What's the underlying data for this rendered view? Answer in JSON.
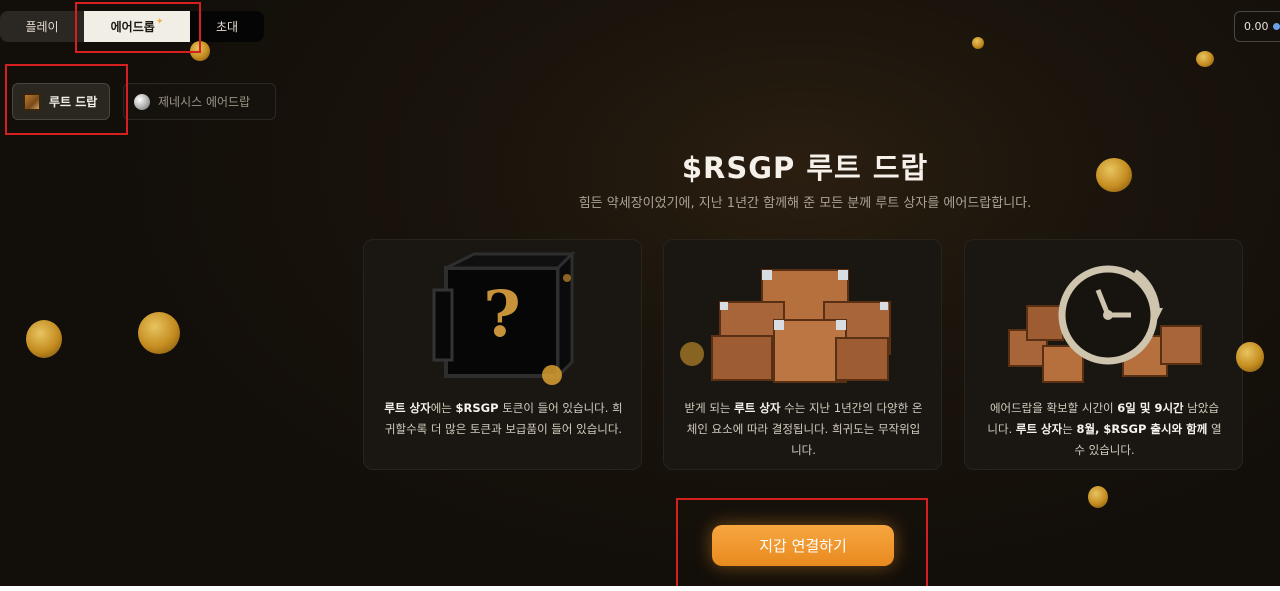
{
  "top_tabs": [
    {
      "label": "플레이"
    },
    {
      "label": "에어드롭"
    },
    {
      "label": "초대"
    }
  ],
  "balance": "0.00",
  "sub_tabs": [
    {
      "label": "루트 드랍"
    },
    {
      "label": "제네시스 에어드랍"
    }
  ],
  "hero": {
    "title": "$RSGP 루트 드랍",
    "subtitle": "힘든 약세장이었기에, 지난 1년간 함께해 준 모든 분께 루트 상자를 에어드랍합니다."
  },
  "cards": [
    {
      "parts": [
        {
          "t": "루트 상자",
          "b": true
        },
        {
          "t": "에는 ",
          "b": false
        },
        {
          "t": "$RSGP",
          "b": true
        },
        {
          "t": " 토큰이 들어 있습니다. 희귀할수록 더 많은 토큰과 보급품이 들어 있습니다.",
          "b": false
        }
      ]
    },
    {
      "parts": [
        {
          "t": "받게 되는 ",
          "b": false
        },
        {
          "t": "루트 상자",
          "b": true
        },
        {
          "t": " 수는 지난 1년간의 다양한 온체인 요소에 따라 결정됩니다. 희귀도는 무작위입니다.",
          "b": false
        }
      ]
    },
    {
      "parts": [
        {
          "t": "에어드랍을 확보할 시간이 ",
          "b": false
        },
        {
          "t": "6일 및 9시간",
          "b": true
        },
        {
          "t": " 남았습니다. ",
          "b": false
        },
        {
          "t": "루트 상자",
          "b": true
        },
        {
          "t": "는 ",
          "b": false
        },
        {
          "t": "8월, $RSGP 출시와 함께",
          "b": true
        },
        {
          "t": " 열 수 있습니다.",
          "b": false
        }
      ]
    }
  ],
  "cta_label": "지갑 연결하기",
  "colors": {
    "accent": "#f39a2e",
    "background": "#120e09",
    "annotation": "#d62020"
  },
  "icons": {
    "loot_tab": "loot-chest-icon",
    "genesis_tab": "silver-orb-icon",
    "card_1": "mystery-chest-icon",
    "card_2": "crate-pile-icon",
    "card_3": "clock-crates-icon"
  }
}
